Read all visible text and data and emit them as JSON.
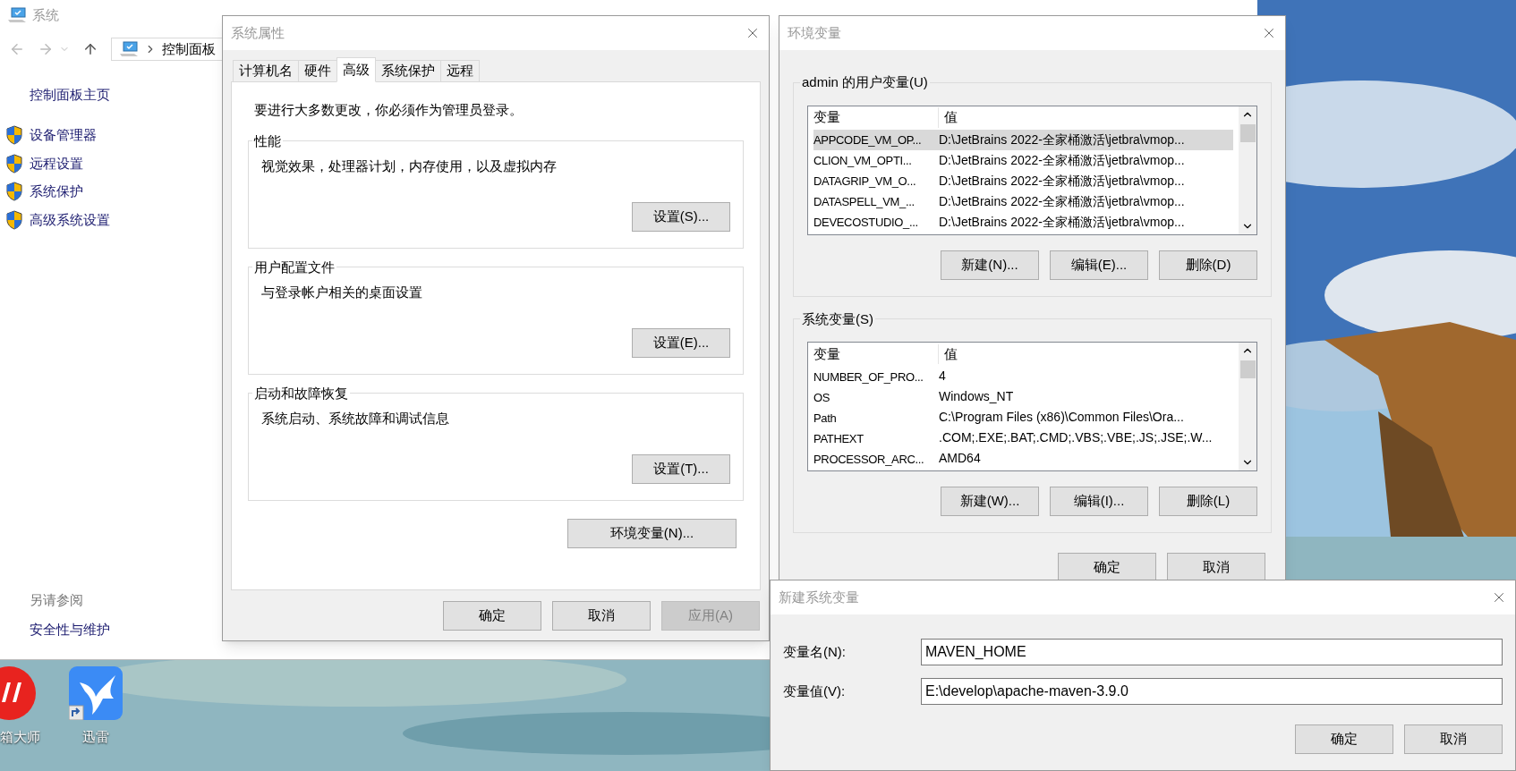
{
  "control_panel": {
    "title": "系统",
    "breadcrumb": [
      "控制面板"
    ],
    "sidebar": {
      "home": "控制面板主页",
      "items": [
        "设备管理器",
        "远程设置",
        "系统保护",
        "高级系统设置"
      ],
      "see_also_heading": "另请参阅",
      "see_also": [
        "安全性与维护"
      ]
    }
  },
  "system_properties": {
    "title": "系统属性",
    "tabs": [
      {
        "label": "计算机名",
        "selected": false
      },
      {
        "label": "硬件",
        "selected": false
      },
      {
        "label": "高级",
        "selected": true
      },
      {
        "label": "系统保护",
        "selected": false
      },
      {
        "label": "远程",
        "selected": false
      }
    ],
    "notice": "要进行大多数更改，你必须作为管理员登录。",
    "groups": [
      {
        "title": "性能",
        "description": "视觉效果，处理器计划，内存使用，以及虚拟内存",
        "button": "设置(S)..."
      },
      {
        "title": "用户配置文件",
        "description": "与登录帐户相关的桌面设置",
        "button": "设置(E)..."
      },
      {
        "title": "启动和故障恢复",
        "description": "系统启动、系统故障和调试信息",
        "button": "设置(T)..."
      }
    ],
    "env_button": "环境变量(N)...",
    "buttons": [
      {
        "label": "确定",
        "disabled": false
      },
      {
        "label": "取消",
        "disabled": false
      },
      {
        "label": "应用(A)",
        "disabled": true
      }
    ]
  },
  "environment_variables": {
    "title": "环境变量",
    "sections": [
      {
        "title": "admin 的用户变量(U)",
        "columns": [
          "变量",
          "值"
        ],
        "rows": [
          {
            "name": "APPCODE_VM_OP...",
            "value": "D:\\JetBrains 2022-全家桶激活\\jetbra\\vmop...",
            "selected": true
          },
          {
            "name": "CLION_VM_OPTI...",
            "value": "D:\\JetBrains 2022-全家桶激活\\jetbra\\vmop...",
            "selected": false
          },
          {
            "name": "DATAGRIP_VM_O...",
            "value": "D:\\JetBrains 2022-全家桶激活\\jetbra\\vmop...",
            "selected": false
          },
          {
            "name": "DATASPELL_VM_...",
            "value": "D:\\JetBrains 2022-全家桶激活\\jetbra\\vmop...",
            "selected": false
          },
          {
            "name": "DEVECOSTUDIO_...",
            "value": "D:\\JetBrains 2022-全家桶激活\\jetbra\\vmop...",
            "selected": false
          }
        ],
        "buttons": [
          "新建(N)...",
          "编辑(E)...",
          "删除(D)"
        ]
      },
      {
        "title": "系统变量(S)",
        "columns": [
          "变量",
          "值"
        ],
        "rows": [
          {
            "name": "NUMBER_OF_PRO...",
            "value": "4",
            "selected": false
          },
          {
            "name": "OS",
            "value": "Windows_NT",
            "selected": false
          },
          {
            "name": "Path",
            "value": "C:\\Program Files (x86)\\Common Files\\Ora...",
            "selected": false
          },
          {
            "name": "PATHEXT",
            "value": ".COM;.EXE;.BAT;.CMD;.VBS;.VBE;.JS;.JSE;.W...",
            "selected": false
          },
          {
            "name": "PROCESSOR_ARC...",
            "value": "AMD64",
            "selected": false
          }
        ],
        "buttons": [
          "新建(W)...",
          "编辑(I)...",
          "删除(L)"
        ]
      }
    ],
    "buttons": [
      "确定",
      "取消"
    ]
  },
  "new_variable": {
    "title": "新建系统变量",
    "fields": [
      {
        "label": "变量名(N):",
        "value": "MAVEN_HOME"
      },
      {
        "label": "变量值(V):",
        "value": "E:\\develop\\apache-maven-3.9.0"
      }
    ],
    "buttons": [
      "确定",
      "取消"
    ]
  },
  "desktop_icons": [
    {
      "label": "箱大师",
      "kind": "mail"
    },
    {
      "label": "迅雷",
      "kind": "bird"
    }
  ]
}
